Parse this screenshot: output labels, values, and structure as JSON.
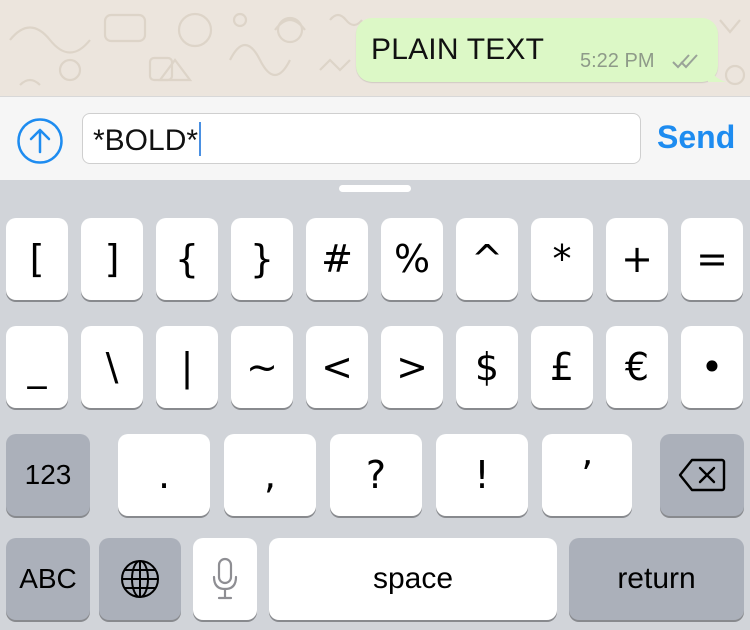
{
  "chat": {
    "message_text": "PLAIN TEXT",
    "message_time": "5:22 PM",
    "bubble_color": "#dcf8c6",
    "wallpaper_color": "#ece5dd"
  },
  "input": {
    "field_value": "*BOLD*",
    "send_label": "Send",
    "attach_icon": "arrow-up-circle-icon",
    "accent_color": "#1e8cf0"
  },
  "keyboard": {
    "row1": [
      "[",
      "]",
      "{",
      "}",
      "#",
      "%",
      "^",
      "*",
      "+",
      "="
    ],
    "row2": [
      "_",
      "\\",
      "|",
      "~",
      "<",
      ">",
      "$",
      "£",
      "€",
      "•"
    ],
    "row3": [
      "123",
      ".",
      ",",
      "?",
      "!",
      "’"
    ],
    "row4": {
      "abc": "ABC",
      "space": "space",
      "return": "return"
    },
    "icons": [
      "globe-icon",
      "microphone-icon",
      "backspace-icon"
    ]
  }
}
